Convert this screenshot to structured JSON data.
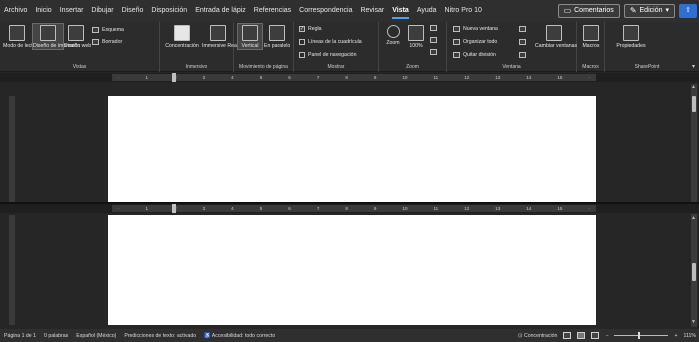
{
  "tabs": [
    "Archivo",
    "Inicio",
    "Insertar",
    "Dibujar",
    "Diseño",
    "Disposición",
    "Entrada de lápiz",
    "Referencias",
    "Correspondencia",
    "Revisar",
    "Vista",
    "Ayuda",
    "Nitro Pro 10"
  ],
  "toolbar": {
    "comments": "Comentarios",
    "editing": "Edición"
  },
  "ribbon": {
    "vistas": {
      "name": "Vistas",
      "read_mode": "Modo de lectura",
      "print_layout": "Diseño de impresión",
      "web_layout": "Diseño web",
      "outline": "Esquema",
      "draft": "Borrador"
    },
    "inmersivo": {
      "name": "Inmersivo",
      "focus": "Concentración",
      "reader": "Immersive Reader"
    },
    "movimiento": {
      "name": "Movimiento de página",
      "vertical": "Vertical",
      "side": "En paralelo"
    },
    "mostrar": {
      "name": "Mostrar",
      "ruler": "Regla",
      "gridlines": "Líneas de la cuadrícula",
      "navigation": "Panel de navegación"
    },
    "zoom": {
      "name": "Zoom",
      "zoom": "Zoom",
      "hundred": "100%"
    },
    "ventana": {
      "name": "Ventana",
      "new_window": "Nueva ventana",
      "arrange": "Organizar todo",
      "remove_split": "Quitar división",
      "switch": "Cambiar ventanas"
    },
    "macros": {
      "name": "Macros",
      "macros": "Macros"
    },
    "sharepoint": {
      "name": "SharePoint",
      "properties": "Propiedades"
    }
  },
  "status": {
    "page": "Página 1 de 1",
    "words": "0 palabras",
    "language": "Español (México)",
    "predictions": "Predicciones de texto: activado",
    "accessibility": "Accesibilidad: todo correcto",
    "focus": "Concentración",
    "zoom": "111%"
  },
  "colors": {
    "accent": "#4aa3f0",
    "ribbon_bg": "#2c2c2c",
    "workspace_bg": "#262626",
    "page": "#ffffff"
  }
}
